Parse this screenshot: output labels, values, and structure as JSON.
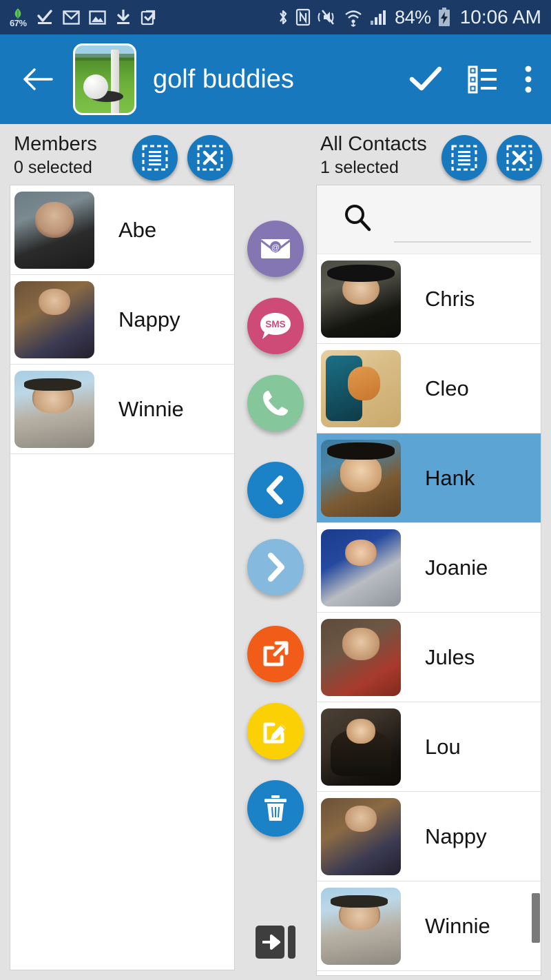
{
  "status_bar": {
    "eco_percent": "67%",
    "left_icons": [
      "eco-battery-icon",
      "download-check-icon",
      "gmail-icon",
      "photo-icon",
      "download-icon",
      "clipboard-check-icon"
    ],
    "right_icons": [
      "bluetooth-icon",
      "nfc-icon",
      "mute-vibrate-icon",
      "wifi-icon",
      "cellular-signal-icon"
    ],
    "battery_percent": "84%",
    "battery_state": "charging",
    "time": "10:06 AM"
  },
  "app_bar": {
    "back_icon": "back-arrow-icon",
    "group_thumbnail": "golf-course-thumbnail",
    "title": "golf buddies",
    "confirm_icon": "checkmark-icon",
    "list_icon": "list-view-icon",
    "overflow_icon": "overflow-menu-icon",
    "background_color": "#1878bd"
  },
  "members_panel": {
    "title": "Members",
    "subtitle": "0 selected",
    "select_all_icon": "select-all-icon",
    "deselect_all_icon": "deselect-all-icon",
    "rows": [
      {
        "name": "Abe",
        "avatar": "av-abe"
      },
      {
        "name": "Nappy",
        "avatar": "av-nappy"
      },
      {
        "name": "Winnie",
        "avatar": "av-winnie"
      }
    ]
  },
  "contacts_panel": {
    "title": "All Contacts",
    "subtitle": "1 selected",
    "select_all_icon": "select-all-icon",
    "deselect_all_icon": "deselect-all-icon",
    "search": {
      "icon": "search-icon",
      "value": "",
      "placeholder": ""
    },
    "rows": [
      {
        "name": "Chris",
        "avatar": "av-chris",
        "selected": false
      },
      {
        "name": "Cleo",
        "avatar": "av-cleo",
        "selected": false
      },
      {
        "name": "Hank",
        "avatar": "av-hank",
        "selected": true
      },
      {
        "name": "Joanie",
        "avatar": "av-joanie",
        "selected": false
      },
      {
        "name": "Jules",
        "avatar": "av-jules",
        "selected": false
      },
      {
        "name": "Lou",
        "avatar": "av-lou",
        "selected": false
      },
      {
        "name": "Nappy",
        "avatar": "av-nappy",
        "selected": false
      },
      {
        "name": "Winnie",
        "avatar": "av-winnie",
        "selected": false
      }
    ],
    "selection_color": "#5ba4d4",
    "scrollbar_visible": true
  },
  "action_buttons": [
    {
      "name": "email-action-button",
      "icon": "email-at-icon",
      "color": "#8376b3"
    },
    {
      "name": "sms-action-button",
      "icon": "sms-bubble-icon",
      "color": "#ce4a77",
      "label": "SMS"
    },
    {
      "name": "call-action-button",
      "icon": "phone-icon",
      "color": "#85c79a"
    },
    {
      "name": "move-left-button",
      "icon": "chevron-left-icon",
      "color": "#1b82c8"
    },
    {
      "name": "move-right-button",
      "icon": "chevron-right-icon",
      "color": "#85b9dd"
    },
    {
      "name": "share-action-button",
      "icon": "external-link-icon",
      "color": "#f25c19"
    },
    {
      "name": "edit-action-button",
      "icon": "edit-pencil-icon",
      "color": "#fbd106"
    },
    {
      "name": "delete-action-button",
      "icon": "trash-icon",
      "color": "#1b82c8"
    },
    {
      "name": "exit-button",
      "icon": "exit-door-icon",
      "color": "#3e3e3e"
    }
  ]
}
